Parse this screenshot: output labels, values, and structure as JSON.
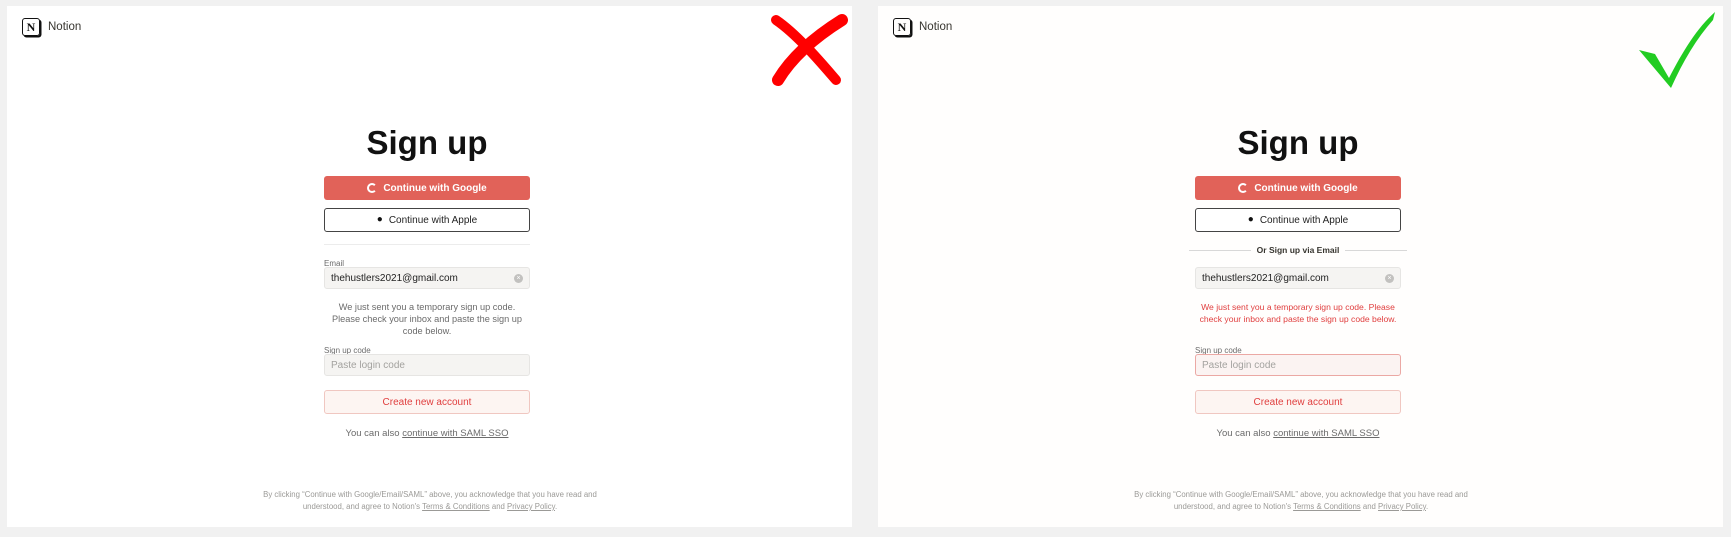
{
  "brand": {
    "name": "Notion",
    "logo_letter": "N"
  },
  "left_panel": {
    "verdict_icon": "cross-mark-icon",
    "title": "Sign up",
    "google_label": "Continue with Google",
    "apple_label": "Continue with Apple",
    "email_label": "Email",
    "email_value": "thehustlers2021@gmail.com",
    "message": "We just sent you a temporary sign up code. Please check your inbox and paste the sign up code below.",
    "code_label": "Sign up code",
    "code_placeholder": "Paste login code",
    "create_label": "Create new account",
    "sso_prefix": "You can also ",
    "sso_link": "continue with SAML SSO",
    "footer_text": "By clicking “Continue with Google/Email/SAML” above, you acknowledge that you have read and understood, and agree to Notion's ",
    "terms_link": "Terms & Conditions",
    "footer_and": " and ",
    "privacy_link": "Privacy Policy",
    "footer_end": "."
  },
  "right_panel": {
    "verdict_icon": "check-mark-icon",
    "title": "Sign up",
    "google_label": "Continue with Google",
    "apple_label": "Continue with Apple",
    "divider_label": "Or Sign up via Email",
    "email_value": "thehustlers2021@gmail.com",
    "message": "We just sent you a temporary sign up code. Please check your inbox and paste the sign up code below.",
    "code_label": "Sign up code",
    "code_placeholder": "Paste login code",
    "create_label": "Create new account",
    "sso_prefix": "You can also ",
    "sso_link": "continue with SAML SSO",
    "footer_text": "By clicking “Continue with Google/Email/SAML” above, you acknowledge that you have read and understood, and agree to Notion's ",
    "terms_link": "Terms & Conditions",
    "footer_and": " and ",
    "privacy_link": "Privacy Policy",
    "footer_end": "."
  },
  "colors": {
    "google_red": "#e16259",
    "error_red": "#e03e3e",
    "cross_red": "#ff0000",
    "check_green": "#22cc22"
  }
}
